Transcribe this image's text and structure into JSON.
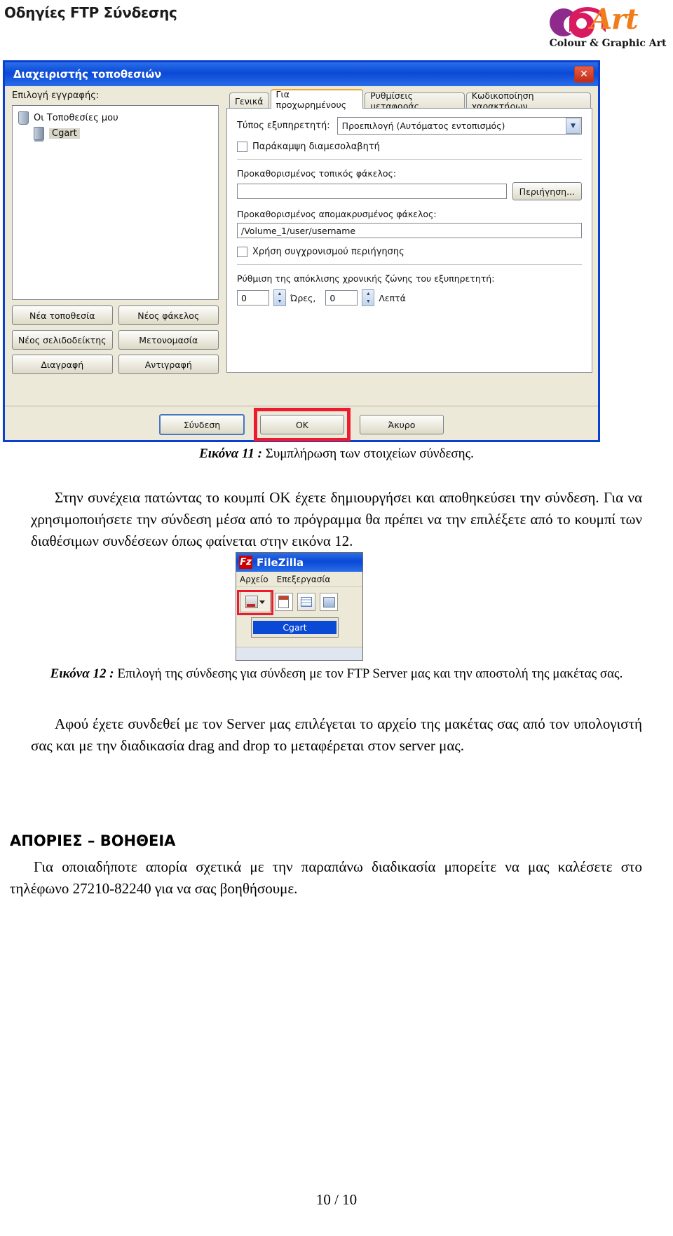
{
  "header": {
    "title": "Οδηγίες FTP Σύνδεσης",
    "logo": {
      "mark_text": "c9",
      "word": "Art",
      "tagline": "Colour & Graphic Art",
      "purple": "#8e2a8b",
      "magenta": "#d81b60",
      "orange": "#f07d1a"
    }
  },
  "dialog": {
    "title": "Διαχειριστής τοποθεσιών",
    "close_label": "✕",
    "left": {
      "select_label": "Επιλογή εγγραφής:",
      "tree": [
        {
          "label": "Οι Τοποθεσίες μου",
          "icon": "folder-icon",
          "selected": false
        },
        {
          "label": "Cgart",
          "icon": "server-icon",
          "selected": true
        }
      ],
      "buttons": [
        "Νέα τοποθεσία",
        "Νέος φάκελος",
        "Νέος σελιδοδείκτης",
        "Μετονομασία",
        "Διαγραφή",
        "Αντιγραφή"
      ]
    },
    "tabs": [
      {
        "label": "Γενικά",
        "active": false
      },
      {
        "label": "Για προχωρημένους",
        "active": true
      },
      {
        "label": "Ρυθμίσεις μεταφοράς",
        "active": false
      },
      {
        "label": "Κωδικοποίηση χαρακτήρων",
        "active": false
      }
    ],
    "advanced": {
      "server_type_label": "Τύπος εξυπηρετητή:",
      "server_type_value": "Προεπιλογή (Αυτόματος εντοπισμός)",
      "bypass_proxy_label": "Παράκαμψη διαμεσολαβητή",
      "bypass_proxy_checked": false,
      "local_dir_label": "Προκαθορισμένος τοπικός φάκελος:",
      "local_dir_value": "",
      "browse_label": "Περιήγηση...",
      "remote_dir_label": "Προκαθορισμένος απομακρυσμένος φάκελος:",
      "remote_dir_value": "/Volume_1/user/username",
      "sync_browse_label": "Χρήση συγχρονισμού περιήγησης",
      "sync_browse_checked": false,
      "timezone_label": "Ρύθμιση της απόκλισης χρονικής ζώνης του εξυπηρετητή:",
      "hours_value": "0",
      "hours_unit": "Ώρες,",
      "minutes_value": "0",
      "minutes_unit": "Λεπτά"
    },
    "footer": {
      "connect_label": "Σύνδεση",
      "ok_label": "OK",
      "cancel_label": "Άκυρο",
      "highlight_color": "#ee1b2e"
    }
  },
  "caption11": {
    "bold": "Εικόνα 11 : ",
    "text": "Συμπλήρωση των στοιχείων σύνδεσης."
  },
  "paragraph1": "Στην συνέχεια πατώντας το κουμπί OK έχετε δημιουργήσει και αποθηκεύσει την σύνδεση. Για να χρησιμοποιήσετε την σύνδεση μέσα από το πρόγραμμα θα πρέπει να την επιλέξετε από το κουμπί των διαθέσιμων συνδέσεων όπως φαίνεται στην εικόνα 12.",
  "filezilla": {
    "logo_text": "Fz",
    "title": "FileZilla",
    "menu": [
      "Αρχείο",
      "Επεξεργασία"
    ],
    "dropdown_item": "Cgart",
    "toolbar_icons": [
      "site-manager-icon",
      "new-tab-icon",
      "message-log-icon",
      "directory-tree-icon"
    ]
  },
  "caption12": {
    "bold": "Εικόνα 12 : ",
    "text": "Επιλογή της σύνδεσης για σύνδεση με τον FTP Server μας και την αποστολή της μακέτας σας."
  },
  "paragraph2": "Αφού έχετε συνδεθεί με τον Server μας επιλέγεται το αρχείο της μακέτας σας από τον υπολογιστή σας και με την διαδικασία drag and drop το μεταφέρεται στον server μας.",
  "help_heading": "ΑΠΟΡΙΕΣ – ΒΟΗΘΕΙΑ",
  "paragraph3": "Για οποιαδήποτε απορία σχετικά με την παραπάνω διαδικασία μπορείτε να μας καλέσετε στο τηλέφωνο 27210-82240 για να σας βοηθήσουμε.",
  "page_number": "10 / 10"
}
